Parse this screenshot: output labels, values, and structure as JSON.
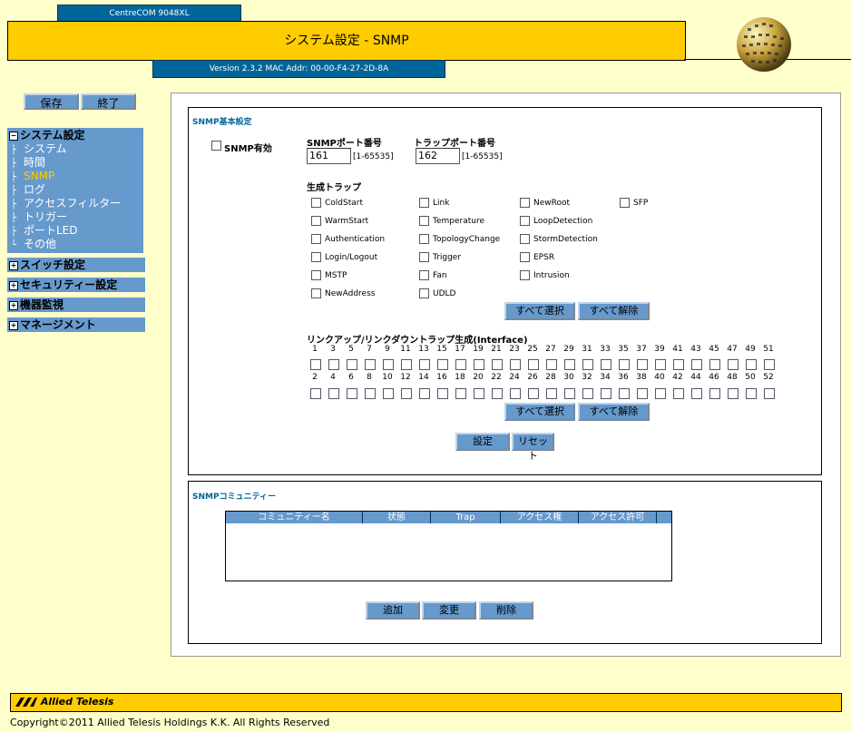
{
  "header": {
    "model": "CentreCOM 9048XL",
    "title": "システム設定 - SNMP",
    "version": "Version 2.3.2 MAC Addr: 00-00-F4-27-2D-8A"
  },
  "side_buttons": {
    "save": "保存",
    "exit": "終了"
  },
  "nav": {
    "system_settings": {
      "label": "システム設定",
      "toggle": "−",
      "items": [
        "システム",
        "時間",
        "SNMP",
        "ログ",
        "アクセスフィルター",
        "トリガー",
        "ポートLED",
        "その他"
      ]
    },
    "collapsed": [
      {
        "label": "スイッチ設定",
        "toggle": "+"
      },
      {
        "label": "セキュリティー設定",
        "toggle": "+"
      },
      {
        "label": "機器監視",
        "toggle": "+"
      },
      {
        "label": "マネージメント",
        "toggle": "+"
      }
    ]
  },
  "snmp_basic": {
    "title": "SNMP基本設定",
    "enable_label": "SNMP有効",
    "port_label": "SNMPポート番号",
    "port_value": "161",
    "port_range": "[1-65535]",
    "trap_port_label": "トラップポート番号",
    "trap_port_value": "162",
    "trap_port_range": "[1-65535]",
    "traps_label": "生成トラップ",
    "traps": [
      [
        "ColdStart",
        "Link",
        "NewRoot",
        "SFP"
      ],
      [
        "WarmStart",
        "Temperature",
        "LoopDetection"
      ],
      [
        "Authentication",
        "TopologyChange",
        "StormDetection"
      ],
      [
        "Login/Logout",
        "Trigger",
        "EPSR"
      ],
      [
        "MSTP",
        "Fan",
        "Intrusion"
      ],
      [
        "NewAddress",
        "UDLD"
      ]
    ],
    "select_all": "すべて選択",
    "clear_all": "すべて解除",
    "link_trap_label": "リンクアップ/リンクダウントラップ生成(Interface)",
    "odd_ports": [
      "1",
      "3",
      "5",
      "7",
      "9",
      "11",
      "13",
      "15",
      "17",
      "19",
      "21",
      "23",
      "25",
      "27",
      "29",
      "31",
      "33",
      "35",
      "37",
      "39",
      "41",
      "43",
      "45",
      "47",
      "49",
      "51"
    ],
    "even_ports": [
      "2",
      "4",
      "6",
      "8",
      "10",
      "12",
      "14",
      "16",
      "18",
      "20",
      "22",
      "24",
      "26",
      "28",
      "30",
      "32",
      "34",
      "36",
      "38",
      "40",
      "42",
      "44",
      "46",
      "48",
      "50",
      "52"
    ],
    "select_all_2": "すべて選択",
    "clear_all_2": "すべて解除",
    "apply": "設定",
    "reset": "リセット"
  },
  "community": {
    "title": "SNMPコミュニティー",
    "columns": [
      "コミュニティー名",
      "状態",
      "Trap",
      "アクセス権",
      "アクセス許可"
    ],
    "add": "追加",
    "edit": "変更",
    "delete": "削除"
  },
  "footer": {
    "logo": "Allied Telesis",
    "copyright": "Copyright©2011 Allied Telesis Holdings K.K. All Rights Reserved"
  },
  "colors": {
    "background": "#ffffcc",
    "accent": "#ffcc00",
    "nav": "#6699cc",
    "header_blue": "#006699"
  }
}
